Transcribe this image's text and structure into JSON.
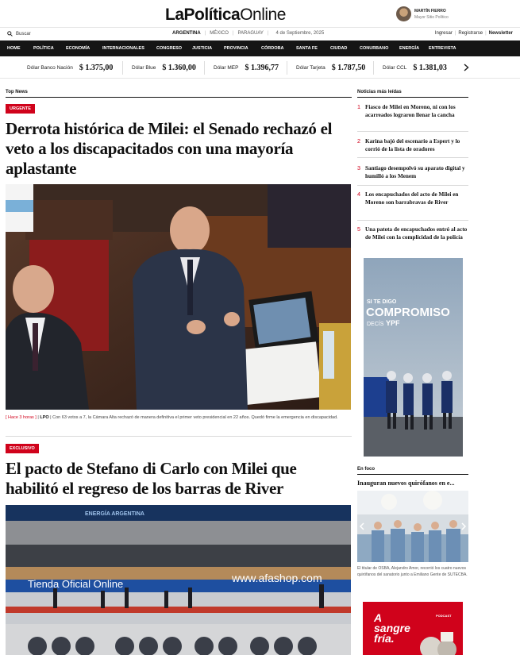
{
  "brand": {
    "bold": "LaPolítica",
    "normal": "Online"
  },
  "author": {
    "name": "MARTÍN FIERRO",
    "subtitle": "Mayor Sitio Político"
  },
  "util": {
    "search_label": "Buscar",
    "countries": [
      "ARGENTINA",
      "MÉXICO",
      "PARAGUAY"
    ],
    "date": "4 de Septiembre, 2025",
    "login": "Ingresar",
    "register": "Registrarse",
    "newsletter": "Newsletter"
  },
  "nav": [
    "HOME",
    "POLÍTICA",
    "ECONOMÍA",
    "INTERNACIONALES",
    "CONGRESO",
    "JUSTICIA",
    "PROVINCIA",
    "CÓRDOBA",
    "SANTA FE",
    "CIUDAD",
    "CONURBANO",
    "ENERGÍA",
    "ENTREVISTA"
  ],
  "ticker": [
    {
      "label": "Dólar Banco Nación",
      "value": "$ 1.375,00"
    },
    {
      "label": "Dólar Blue",
      "value": "$ 1.360,00"
    },
    {
      "label": "Dólar MEP",
      "value": "$ 1.396,77"
    },
    {
      "label": "Dólar Tarjeta",
      "value": "$ 1.787,50"
    },
    {
      "label": "Dólar CCL",
      "value": "$ 1.381,03"
    }
  ],
  "top_news": {
    "section": "Top News",
    "badge": "URGENTE",
    "headline": "Derrota histórica de Milei: el Senado rechazó el veto a los discapacitados con una mayoría aplastante",
    "caption_time": "[ Hace 3 horas ]",
    "caption_source": "LPO",
    "caption_text": "Con 63 votos a 7, la Cámara Alta rechazó de manera definitiva el primer veto presidencial en 22 años. Quedó firme la emergencia en discapacidad."
  },
  "second_news": {
    "badge": "EXCLUSIVO",
    "headline": "El pacto de Stefano di Carlo con Milei que habilitó el regreso de los barras de River",
    "photo_text_1": "Tienda Oficial Online",
    "photo_text_2": "www.afashop.com",
    "photo_text_3": "ENERGÍA ARGENTINA"
  },
  "most_read": {
    "title": "Noticias más leídas",
    "items": [
      {
        "n": "1",
        "text": "Fiasco de Milei en Moreno, ni con los acarreados lograron llenar la cancha"
      },
      {
        "n": "2",
        "text": "Karina bajó del escenario a Espert y lo corrió de la lista de oradores"
      },
      {
        "n": "3",
        "text": "Santiago desempolvó su aparato digital y humilló a los Menem"
      },
      {
        "n": "4",
        "text": "Los encapuchados del acto de Milei en Moreno son barrabravas de River"
      },
      {
        "n": "5",
        "text": "Una patota de encapuchados entró al acto de Milei con la complicidad de la policía"
      }
    ]
  },
  "ad_ypf": {
    "line1": "SI TE DIGO",
    "line2": "COMPROMISO",
    "line3": "DECÍS",
    "brand": "YPF"
  },
  "en_foco": {
    "section": "En foco",
    "title": "Inauguran nuevos quirófanos en e...",
    "caption": "El titular de OSBA, Alejandro Amor, recorrió los cuatro nuevos quirófanos del sanatorio junto a Emiliano Gente de SUTECBA."
  },
  "ad_podcast": {
    "line1": "A",
    "line2": "sangre",
    "line3": "fría.",
    "tag": "PODCAST"
  },
  "colors": {
    "accent": "#d0021b",
    "nav_bg": "#151515"
  }
}
